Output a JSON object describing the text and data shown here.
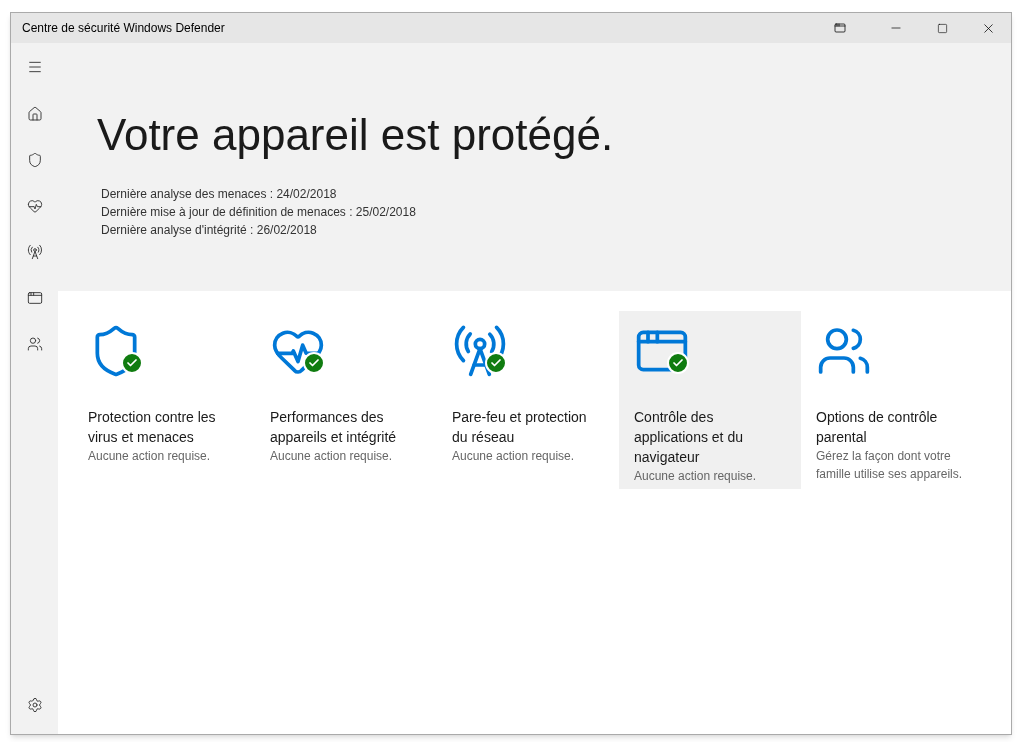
{
  "window": {
    "title": "Centre de sécurité Windows Defender"
  },
  "hero": {
    "heading": "Votre appareil est protégé.",
    "lines": [
      "Dernière analyse des menaces : 24/02/2018",
      "Dernière mise à jour de définition de menaces : 25/02/2018",
      "Dernière analyse d'intégrité : 26/02/2018"
    ]
  },
  "tiles": [
    {
      "kind": "shield",
      "title": "Protection contre les virus et menaces",
      "subtitle": "Aucune action requise.",
      "ok": true,
      "selected": false
    },
    {
      "kind": "heart",
      "title": "Performances des appareils et intégrité",
      "subtitle": "Aucune action requise.",
      "ok": true,
      "selected": false
    },
    {
      "kind": "antenna",
      "title": "Pare-feu et protection du réseau",
      "subtitle": "Aucune action requise.",
      "ok": true,
      "selected": false
    },
    {
      "kind": "browser",
      "title": "Contrôle des applications et du navigateur",
      "subtitle": "Aucune action requise.",
      "ok": true,
      "selected": true
    },
    {
      "kind": "family",
      "title": "Options de contrôle parental",
      "subtitle": "Gérez la façon dont votre famille utilise ses appareils.",
      "ok": false,
      "selected": false
    }
  ]
}
